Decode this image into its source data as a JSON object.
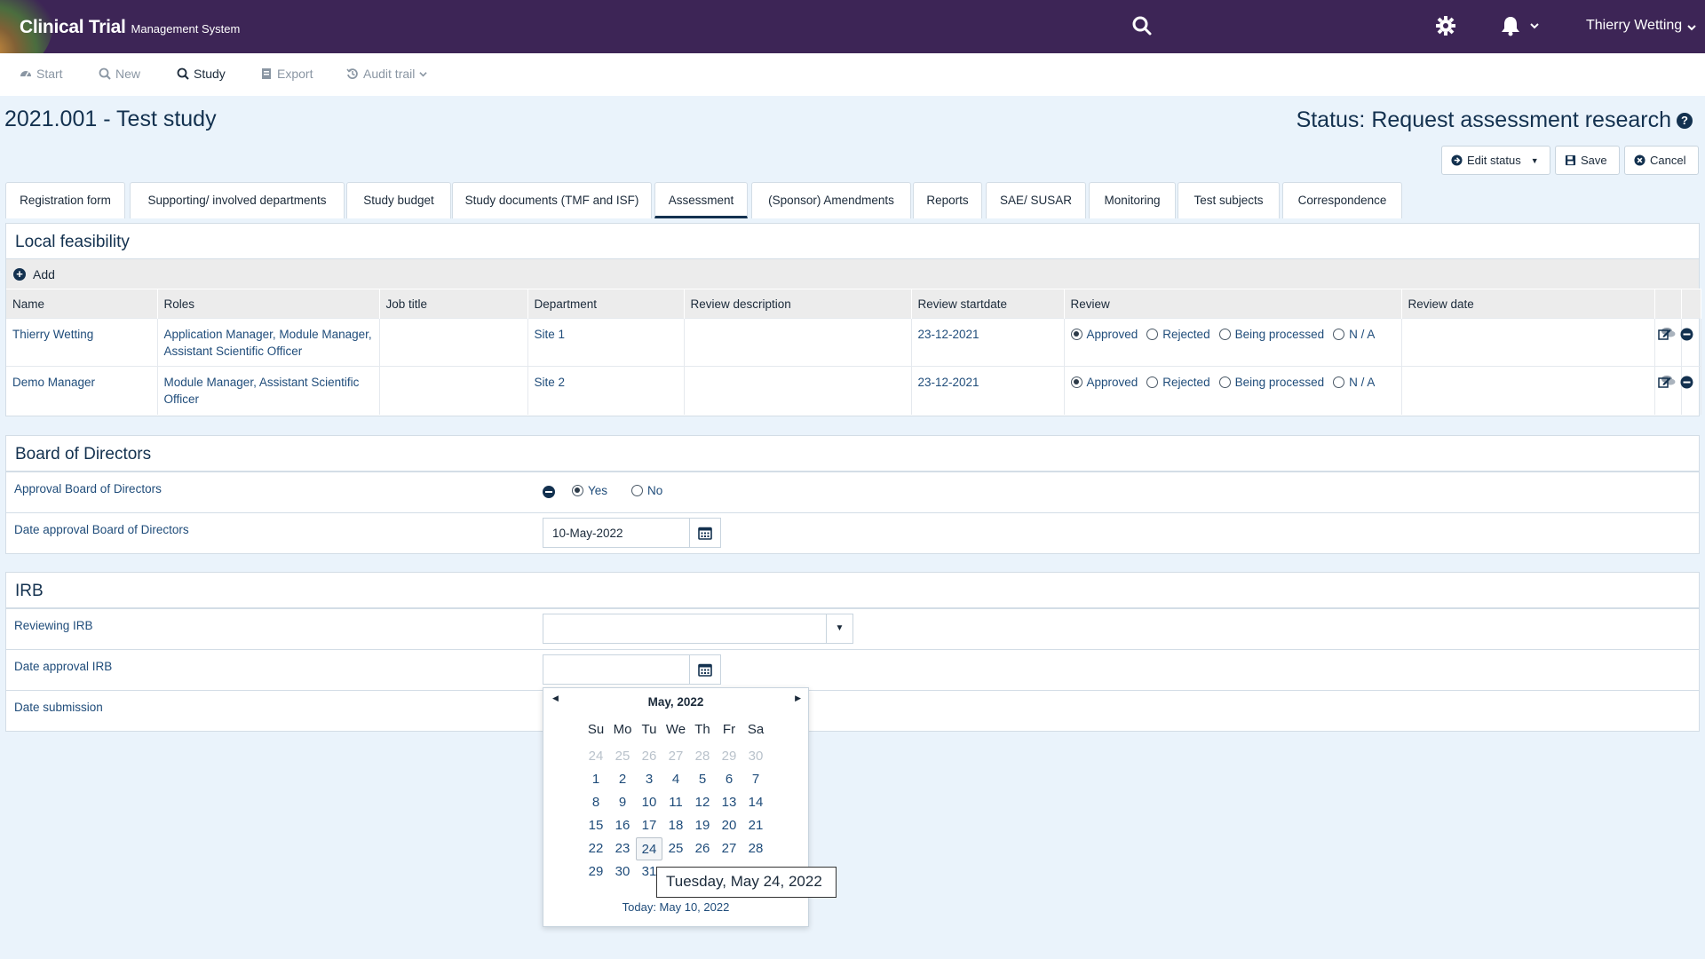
{
  "app": {
    "title": "Clinical Trial",
    "subtitle": "Management System",
    "user": "Thierry Wetting"
  },
  "toolbar": {
    "start": "Start",
    "new": "New",
    "study": "Study",
    "export": "Export",
    "audit_trail": "Audit trail"
  },
  "page": {
    "title": "2021.001 - Test study",
    "status": "Status: Request assessment research"
  },
  "actions": {
    "edit_status": "Edit status",
    "save": "Save",
    "cancel": "Cancel"
  },
  "tabs": [
    "Registration form",
    "Supporting/ involved departments",
    "Study budget",
    "Study documents (TMF and ISF)",
    "Assessment",
    "(Sponsor) Amendments",
    "Reports",
    "SAE/ SUSAR",
    "Monitoring",
    "Test subjects",
    "Correspondence"
  ],
  "local_feasibility": {
    "title": "Local feasibility",
    "add_label": "Add",
    "columns": [
      "Name",
      "Roles",
      "Job title",
      "Department",
      "Review description",
      "Review startdate",
      "Review",
      "Review date"
    ],
    "review_options": [
      "Approved",
      "Rejected",
      "Being processed",
      "N / A"
    ],
    "rows": [
      {
        "name": "Thierry Wetting",
        "roles": "Application Manager, Module Manager, Assistant Scientific Officer",
        "job_title": "",
        "department": "Site 1",
        "review_description": "",
        "review_startdate": "23-12-2021",
        "review": "Approved",
        "review_date": ""
      },
      {
        "name": "Demo Manager",
        "roles": "Module Manager, Assistant Scientific Officer",
        "job_title": "",
        "department": "Site 2",
        "review_description": "",
        "review_startdate": "23-12-2021",
        "review": "Approved",
        "review_date": ""
      }
    ]
  },
  "board": {
    "title": "Board of Directors",
    "approval_label": "Approval Board of Directors",
    "yes": "Yes",
    "no": "No",
    "approval_value": "Yes",
    "date_label": "Date approval Board of Directors",
    "date_value": "10-May-2022"
  },
  "irb": {
    "title": "IRB",
    "reviewing_label": "Reviewing IRB",
    "reviewing_value": "",
    "date_label": "Date approval IRB",
    "date_value": "",
    "submission_label": "Date submission"
  },
  "datepicker": {
    "month_label": "May, 2022",
    "weekdays": [
      "Su",
      "Mo",
      "Tu",
      "We",
      "Th",
      "Fr",
      "Sa"
    ],
    "weeks": [
      [
        "24",
        "25",
        "26",
        "27",
        "28",
        "29",
        "30"
      ],
      [
        "1",
        "2",
        "3",
        "4",
        "5",
        "6",
        "7"
      ],
      [
        "8",
        "9",
        "10",
        "11",
        "12",
        "13",
        "14"
      ],
      [
        "15",
        "16",
        "17",
        "18",
        "19",
        "20",
        "21"
      ],
      [
        "22",
        "23",
        "24",
        "25",
        "26",
        "27",
        "28"
      ],
      [
        "29",
        "30",
        "31",
        "",
        "",
        "",
        ""
      ]
    ],
    "today_label": "Today: May 10, 2022",
    "hover_day": "24",
    "tooltip": "Tuesday, May 24, 2022"
  }
}
